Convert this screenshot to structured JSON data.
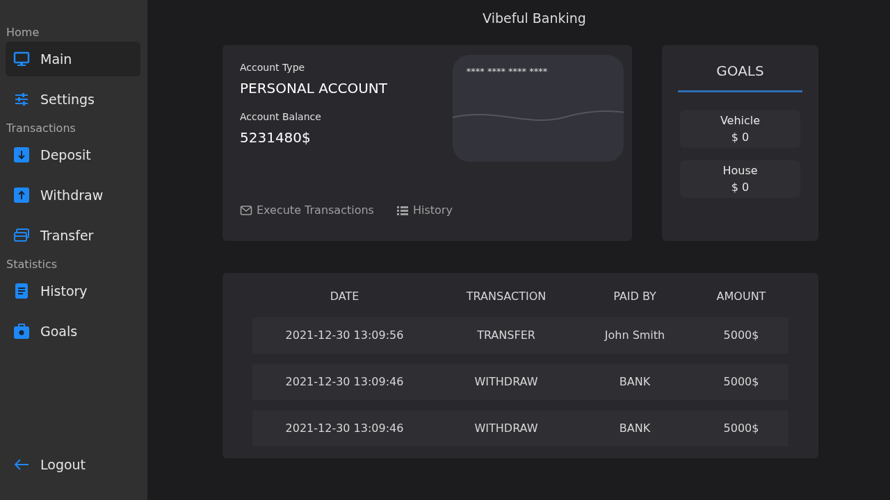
{
  "app_title": "Vibeful Banking",
  "sidebar": {
    "sections": [
      {
        "heading": "Home",
        "items": [
          {
            "label": "Main",
            "selected": true
          },
          {
            "label": "Settings",
            "selected": false
          }
        ]
      },
      {
        "heading": "Transactions",
        "items": [
          {
            "label": "Deposit",
            "selected": false
          },
          {
            "label": "Withdraw",
            "selected": false
          },
          {
            "label": "Transfer",
            "selected": false
          }
        ]
      },
      {
        "heading": "Statistics",
        "items": [
          {
            "label": "History",
            "selected": false
          },
          {
            "label": "Goals",
            "selected": false
          }
        ]
      }
    ],
    "logout": "Logout"
  },
  "account": {
    "type_label": "Account Type",
    "type_value": "PERSONAL ACCOUNT",
    "balance_label": "Account Balance",
    "balance_value": "5231480$",
    "card_number": "**** **** **** ****",
    "actions": [
      "Execute Transactions",
      "History"
    ]
  },
  "goals": {
    "title": "GOALS",
    "items": [
      {
        "name": "Vehicle",
        "amount": "$ 0"
      },
      {
        "name": "House",
        "amount": "$ 0"
      }
    ]
  },
  "table": {
    "columns": [
      "DATE",
      "TRANSACTION",
      "PAID BY",
      "AMOUNT"
    ],
    "rows": [
      [
        "2021-12-30 13:09:56",
        "TRANSFER",
        "John Smith",
        "5000$"
      ],
      [
        "2021-12-30 13:09:46",
        "WITHDRAW",
        "BANK",
        "5000$"
      ],
      [
        "2021-12-30 13:09:46",
        "WITHDRAW",
        "BANK",
        "5000$"
      ]
    ]
  }
}
